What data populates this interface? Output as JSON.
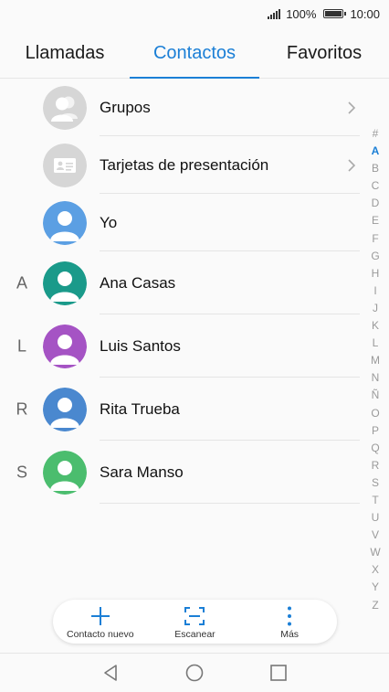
{
  "status_bar": {
    "battery_percent": "100%",
    "time": "10:00"
  },
  "tabs": [
    {
      "label": "Llamadas",
      "active": false
    },
    {
      "label": "Contactos",
      "active": true
    },
    {
      "label": "Favoritos",
      "active": false
    }
  ],
  "list": {
    "groups_label": "Grupos",
    "cards_label": "Tarjetas de presentación",
    "me_label": "Yo",
    "contacts": [
      {
        "letter": "A",
        "name": "Ana Casas",
        "color": "#1a9a8a"
      },
      {
        "letter": "L",
        "name": "Luis Santos",
        "color": "#a553c4"
      },
      {
        "letter": "R",
        "name": "Rita Trueba",
        "color": "#4a88cf"
      },
      {
        "letter": "S",
        "name": "Sara Manso",
        "color": "#4bbd6e"
      }
    ]
  },
  "index_letters": [
    "#",
    "A",
    "B",
    "C",
    "D",
    "E",
    "F",
    "G",
    "H",
    "I",
    "J",
    "K",
    "L",
    "M",
    "N",
    "Ñ",
    "O",
    "P",
    "Q",
    "R",
    "S",
    "T",
    "U",
    "V",
    "W",
    "X",
    "Y",
    "Z"
  ],
  "index_active": "A",
  "actions": {
    "new_contact": "Contacto nuevo",
    "scan": "Escanear",
    "more": "Más"
  },
  "colors": {
    "accent": "#1b7fd6",
    "me_avatar": "#5b9fe3",
    "placeholder_avatar": "#d6d6d6"
  }
}
